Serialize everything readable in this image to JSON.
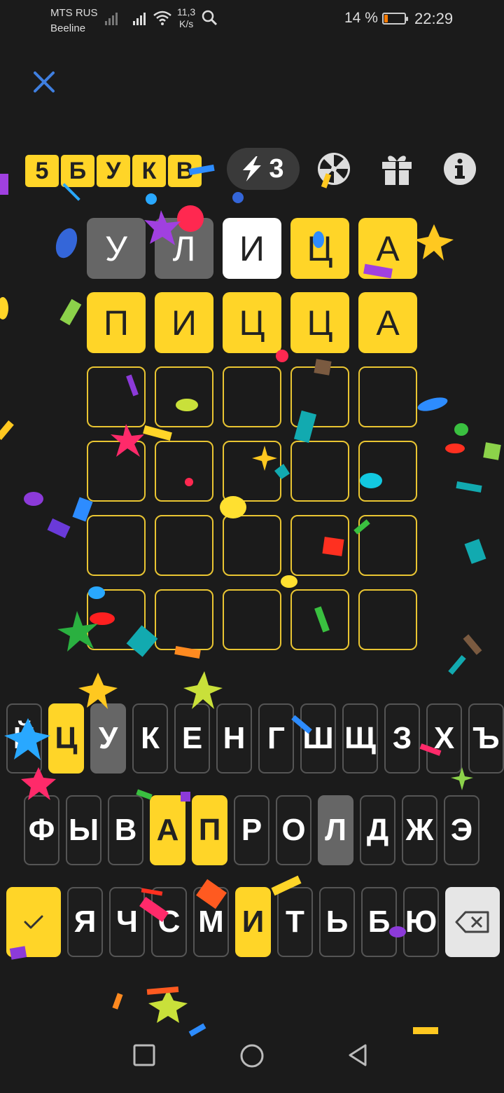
{
  "status_bar": {
    "carrier_1": "MTS RUS",
    "carrier_2": "Beeline",
    "speed_value": "11,3",
    "speed_unit": "K/s",
    "battery": "14 %",
    "time": "22:29"
  },
  "header": {
    "logo_letters": [
      "5",
      "Б",
      "У",
      "К",
      "В"
    ],
    "hints_count": "3",
    "icons": [
      "close-icon",
      "lightning-icon",
      "wheel-icon",
      "gift-icon",
      "info-icon"
    ]
  },
  "grid": {
    "rows": [
      [
        {
          "letter": "У",
          "state": "absent"
        },
        {
          "letter": "Л",
          "state": "absent"
        },
        {
          "letter": "И",
          "state": "present"
        },
        {
          "letter": "Ц",
          "state": "correct"
        },
        {
          "letter": "А",
          "state": "correct"
        }
      ],
      [
        {
          "letter": "П",
          "state": "correct"
        },
        {
          "letter": "И",
          "state": "correct"
        },
        {
          "letter": "Ц",
          "state": "correct"
        },
        {
          "letter": "Ц",
          "state": "correct"
        },
        {
          "letter": "А",
          "state": "correct"
        }
      ],
      [
        {
          "letter": "",
          "state": "empty"
        },
        {
          "letter": "",
          "state": "empty"
        },
        {
          "letter": "",
          "state": "empty"
        },
        {
          "letter": "",
          "state": "empty"
        },
        {
          "letter": "",
          "state": "empty"
        }
      ],
      [
        {
          "letter": "",
          "state": "empty"
        },
        {
          "letter": "",
          "state": "empty"
        },
        {
          "letter": "",
          "state": "empty"
        },
        {
          "letter": "",
          "state": "empty"
        },
        {
          "letter": "",
          "state": "empty"
        }
      ],
      [
        {
          "letter": "",
          "state": "empty"
        },
        {
          "letter": "",
          "state": "empty"
        },
        {
          "letter": "",
          "state": "empty"
        },
        {
          "letter": "",
          "state": "empty"
        },
        {
          "letter": "",
          "state": "empty"
        }
      ],
      [
        {
          "letter": "",
          "state": "empty"
        },
        {
          "letter": "",
          "state": "empty"
        },
        {
          "letter": "",
          "state": "empty"
        },
        {
          "letter": "",
          "state": "empty"
        },
        {
          "letter": "",
          "state": "empty"
        }
      ]
    ]
  },
  "keyboard": {
    "row1": [
      {
        "k": "Й",
        "s": "default"
      },
      {
        "k": "Ц",
        "s": "correct"
      },
      {
        "k": "У",
        "s": "absent"
      },
      {
        "k": "К",
        "s": "default"
      },
      {
        "k": "Е",
        "s": "default"
      },
      {
        "k": "Н",
        "s": "default"
      },
      {
        "k": "Г",
        "s": "default"
      },
      {
        "k": "Ш",
        "s": "default"
      },
      {
        "k": "Щ",
        "s": "default"
      },
      {
        "k": "З",
        "s": "default"
      },
      {
        "k": "Х",
        "s": "default"
      },
      {
        "k": "Ъ",
        "s": "default"
      }
    ],
    "row2": [
      {
        "k": "Ф",
        "s": "default"
      },
      {
        "k": "Ы",
        "s": "default"
      },
      {
        "k": "В",
        "s": "default"
      },
      {
        "k": "А",
        "s": "correct"
      },
      {
        "k": "П",
        "s": "correct"
      },
      {
        "k": "Р",
        "s": "default"
      },
      {
        "k": "О",
        "s": "default"
      },
      {
        "k": "Л",
        "s": "absent"
      },
      {
        "k": "Д",
        "s": "default"
      },
      {
        "k": "Ж",
        "s": "default"
      },
      {
        "k": "Э",
        "s": "default"
      }
    ],
    "row3": [
      {
        "k": "Я",
        "s": "default"
      },
      {
        "k": "Ч",
        "s": "default"
      },
      {
        "k": "С",
        "s": "default"
      },
      {
        "k": "М",
        "s": "default"
      },
      {
        "k": "И",
        "s": "correct"
      },
      {
        "k": "Т",
        "s": "default"
      },
      {
        "k": "Ь",
        "s": "default"
      },
      {
        "k": "Б",
        "s": "default"
      },
      {
        "k": "Ю",
        "s": "default"
      }
    ],
    "enter_icon": "check-icon",
    "delete_icon": "backspace-icon"
  },
  "colors": {
    "correct": "#ffd528",
    "absent": "#666666",
    "present": "#ffffff",
    "background": "#1b1b1b",
    "accent_close": "#3f7fe0"
  }
}
